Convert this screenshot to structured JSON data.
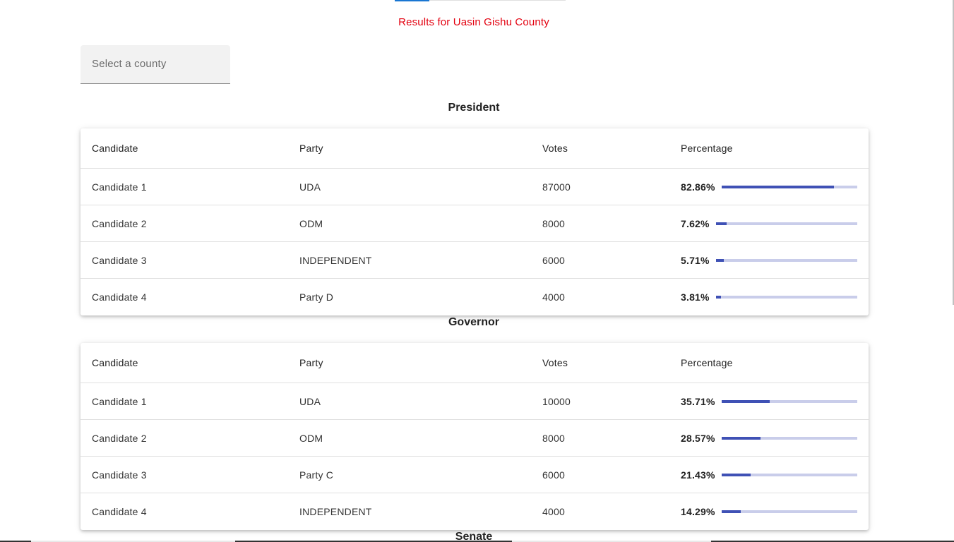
{
  "header": {
    "results_title": "Results for Uasin Gishu County"
  },
  "county_select": {
    "placeholder": "Select a county"
  },
  "columns": {
    "candidate": "Candidate",
    "party": "Party",
    "votes": "Votes",
    "percentage": "Percentage"
  },
  "sections": {
    "president": {
      "heading": "President",
      "rows": [
        {
          "candidate": "Candidate 1",
          "party": "UDA",
          "votes": "87000",
          "percentage": "82.86%",
          "fraction": 0.8286
        },
        {
          "candidate": "Candidate 2",
          "party": "ODM",
          "votes": "8000",
          "percentage": "7.62%",
          "fraction": 0.0762
        },
        {
          "candidate": "Candidate 3",
          "party": "INDEPENDENT",
          "votes": "6000",
          "percentage": "5.71%",
          "fraction": 0.0571
        },
        {
          "candidate": "Candidate 4",
          "party": "Party D",
          "votes": "4000",
          "percentage": "3.81%",
          "fraction": 0.0381
        }
      ]
    },
    "governor": {
      "heading": "Governor",
      "rows": [
        {
          "candidate": "Candidate 1",
          "party": "UDA",
          "votes": "10000",
          "percentage": "35.71%",
          "fraction": 0.3571
        },
        {
          "candidate": "Candidate 2",
          "party": "ODM",
          "votes": "8000",
          "percentage": "28.57%",
          "fraction": 0.2857
        },
        {
          "candidate": "Candidate 3",
          "party": "Party C",
          "votes": "6000",
          "percentage": "21.43%",
          "fraction": 0.2143
        },
        {
          "candidate": "Candidate 4",
          "party": "INDEPENDENT",
          "votes": "4000",
          "percentage": "14.29%",
          "fraction": 0.1429
        }
      ]
    },
    "senate": {
      "heading": "Senate"
    }
  },
  "colors": {
    "title_red": "#e3000f",
    "bar_fill": "#3f51b5",
    "bar_track": "#c9cdea",
    "tab_indicator": "#1976d2"
  }
}
